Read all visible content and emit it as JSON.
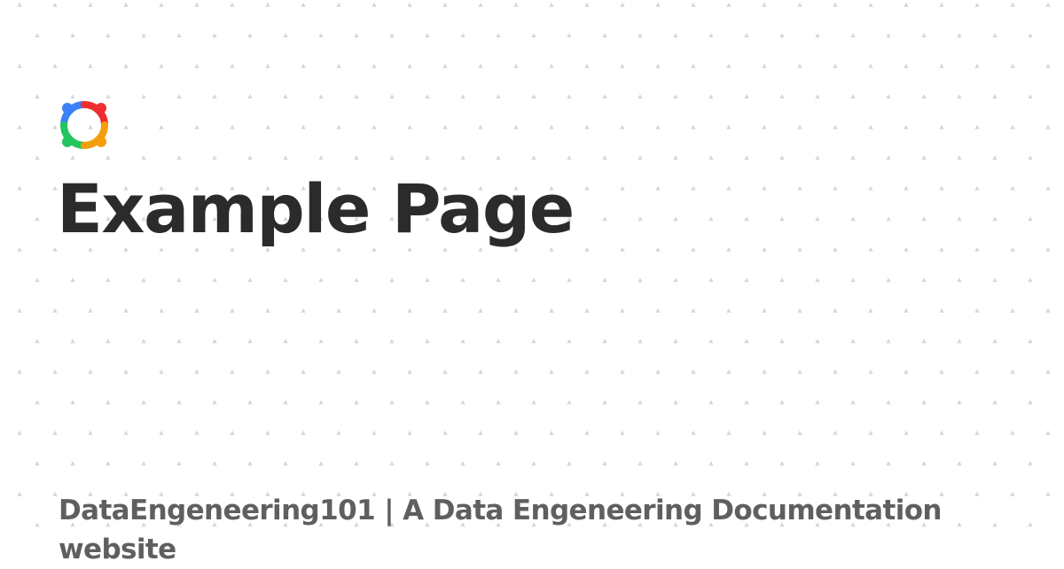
{
  "page": {
    "title": "Example Page",
    "site_subtitle": "DataEngeneering101 | A Data Engeneering Documentation website"
  },
  "logo": {
    "icon": "multicolor-ring-logo",
    "colors": {
      "blue": "#3b82f6",
      "red": "#ef2f2f",
      "green": "#22c55e",
      "orange": "#f59e0b"
    }
  },
  "background": {
    "color": "#ffffff",
    "pattern": "dot-grid",
    "dot_color": "#d7d7d7"
  },
  "text_colors": {
    "title": "#2b2b2b",
    "subtitle": "#5f5f5f"
  }
}
